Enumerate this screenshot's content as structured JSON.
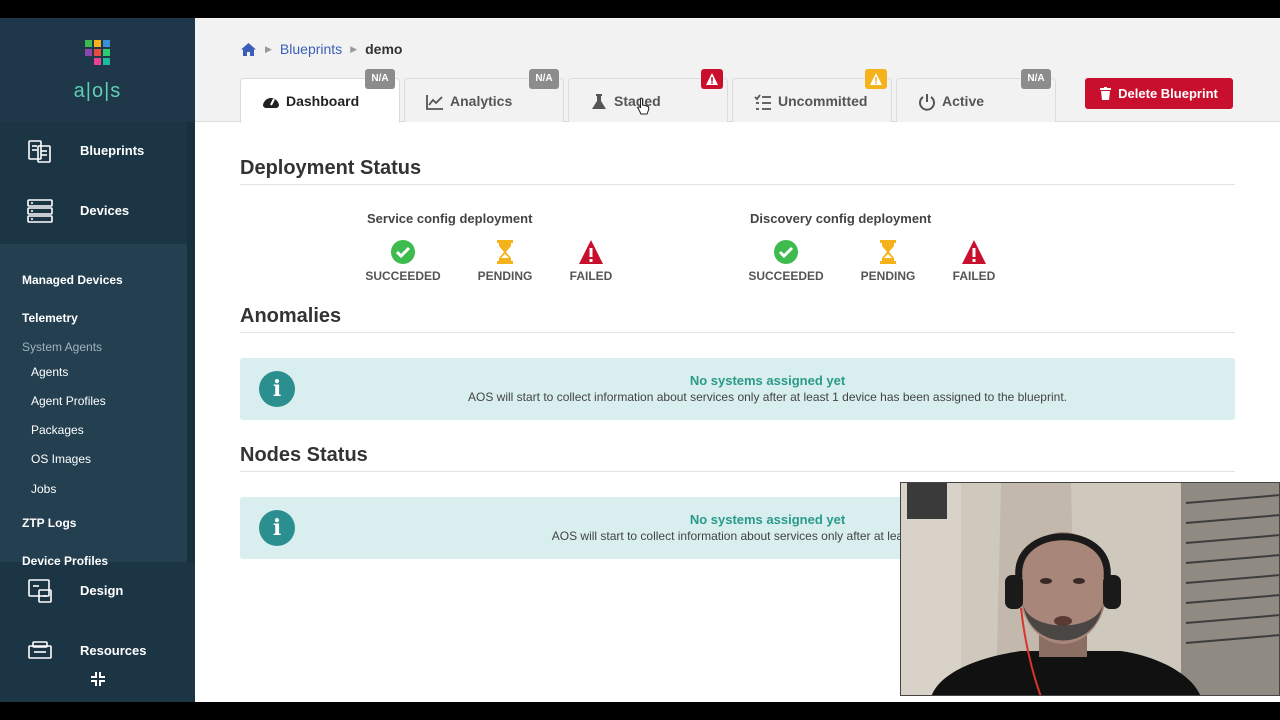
{
  "logo": {
    "text": "a|o|s"
  },
  "sidebar": {
    "main_items": [
      {
        "label": "Blueprints",
        "icon": "blueprints-icon"
      },
      {
        "label": "Devices",
        "icon": "devices-icon"
      },
      {
        "label": "Design",
        "icon": "design-icon"
      },
      {
        "label": "Resources",
        "icon": "resources-icon"
      }
    ],
    "sub_items": [
      {
        "label": "Managed Devices"
      },
      {
        "label": "Telemetry"
      },
      {
        "label": "System Agents"
      },
      {
        "label": "Agents"
      },
      {
        "label": "Agent Profiles"
      },
      {
        "label": "Packages"
      },
      {
        "label": "OS Images"
      },
      {
        "label": "Jobs"
      },
      {
        "label": "ZTP Logs"
      },
      {
        "label": "Device Profiles"
      }
    ]
  },
  "breadcrumb": {
    "home_icon": "home-icon",
    "link": "Blueprints",
    "current": "demo"
  },
  "tabs": [
    {
      "label": "Dashboard",
      "icon": "dashboard-icon",
      "badge": "N/A"
    },
    {
      "label": "Analytics",
      "icon": "analytics-icon",
      "badge": "N/A"
    },
    {
      "label": "Staged",
      "icon": "flask-icon",
      "badge": "!"
    },
    {
      "label": "Uncommitted",
      "icon": "uncommitted-icon",
      "badge": "!"
    },
    {
      "label": "Active",
      "icon": "power-icon",
      "badge": "N/A"
    }
  ],
  "delete_button": {
    "label": "Delete Blueprint"
  },
  "deployment_status": {
    "title": "Deployment Status",
    "groups": [
      {
        "title": "Service config deployment",
        "statuses": [
          "SUCCEEDED",
          "PENDING",
          "FAILED"
        ]
      },
      {
        "title": "Discovery config deployment",
        "statuses": [
          "SUCCEEDED",
          "PENDING",
          "FAILED"
        ]
      }
    ]
  },
  "anomalies": {
    "title": "Anomalies",
    "info_title": "No systems assigned yet",
    "info_text": "AOS will start to collect information about services only after at least 1 device has been assigned to the blueprint."
  },
  "nodes_status": {
    "title": "Nodes Status",
    "info_title": "No systems assigned yet",
    "info_text": "AOS will start to collect information about services only after at least 1 device has"
  },
  "colors": {
    "sidebar": "#1c3544",
    "accent_teal": "#2a9a8a",
    "danger": "#c8102e",
    "warning": "#f6b21b",
    "success": "#3dbb4e",
    "link": "#3b5fb8"
  }
}
